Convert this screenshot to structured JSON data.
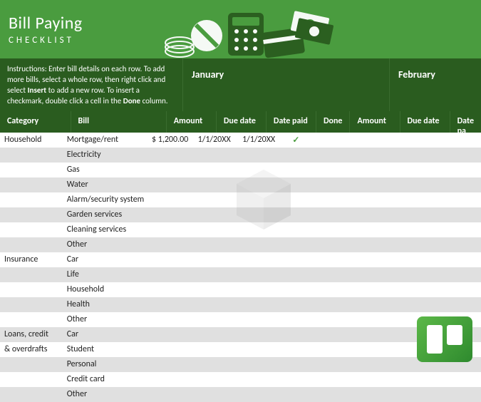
{
  "header": {
    "title": "Bill Paying",
    "subtitle": "CHECKLIST"
  },
  "instructions": {
    "prefix": "Instructions: Enter bill details on each row. To add more bills, select a whole row, then right click and select ",
    "bold1": "Insert",
    "mid": " to add a new row. To insert a checkmark, double click a cell in the ",
    "bold2": "Done",
    "suffix": " column."
  },
  "months": {
    "jan": "January",
    "feb": "February"
  },
  "columns": {
    "category": "Category",
    "bill": "Bill",
    "amount": "Amount",
    "due": "Due date",
    "paid": "Date paid",
    "done": "Done",
    "paid_cut": "Date pa"
  },
  "rows": [
    {
      "category": "Household",
      "bill": "Mortgage/rent",
      "amount": "$    1,200.00",
      "due": "1/1/20XX",
      "paid": "1/1/20XX",
      "done": "✓"
    },
    {
      "category": "",
      "bill": "Electricity",
      "amount": "",
      "due": "",
      "paid": "",
      "done": ""
    },
    {
      "category": "",
      "bill": "Gas",
      "amount": "",
      "due": "",
      "paid": "",
      "done": ""
    },
    {
      "category": "",
      "bill": "Water",
      "amount": "",
      "due": "",
      "paid": "",
      "done": ""
    },
    {
      "category": "",
      "bill": "Alarm/security system",
      "amount": "",
      "due": "",
      "paid": "",
      "done": ""
    },
    {
      "category": "",
      "bill": "Garden services",
      "amount": "",
      "due": "",
      "paid": "",
      "done": ""
    },
    {
      "category": "",
      "bill": "Cleaning services",
      "amount": "",
      "due": "",
      "paid": "",
      "done": ""
    },
    {
      "category": "",
      "bill": "Other",
      "amount": "",
      "due": "",
      "paid": "",
      "done": ""
    },
    {
      "category": "Insurance",
      "bill": "Car",
      "amount": "",
      "due": "",
      "paid": "",
      "done": ""
    },
    {
      "category": "",
      "bill": "Life",
      "amount": "",
      "due": "",
      "paid": "",
      "done": ""
    },
    {
      "category": "",
      "bill": "Household",
      "amount": "",
      "due": "",
      "paid": "",
      "done": ""
    },
    {
      "category": "",
      "bill": "Health",
      "amount": "",
      "due": "",
      "paid": "",
      "done": ""
    },
    {
      "category": "",
      "bill": "Other",
      "amount": "",
      "due": "",
      "paid": "",
      "done": ""
    },
    {
      "category": "Loans, credit",
      "bill": "Car",
      "amount": "",
      "due": "",
      "paid": "",
      "done": ""
    },
    {
      "category": "& overdrafts",
      "bill": "Student",
      "amount": "",
      "due": "",
      "paid": "",
      "done": ""
    },
    {
      "category": "",
      "bill": "Personal",
      "amount": "",
      "due": "",
      "paid": "",
      "done": ""
    },
    {
      "category": "",
      "bill": "Credit card",
      "amount": "",
      "due": "",
      "paid": "",
      "done": ""
    },
    {
      "category": "",
      "bill": "Other",
      "amount": "",
      "due": "",
      "paid": "",
      "done": ""
    }
  ]
}
